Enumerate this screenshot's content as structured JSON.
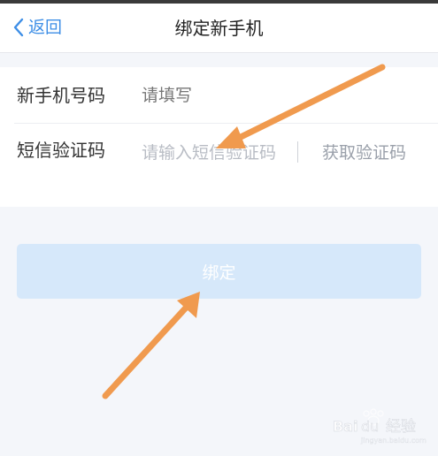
{
  "navbar": {
    "back_label": "返回",
    "title": "绑定新手机"
  },
  "form": {
    "phone": {
      "label": "新手机号码",
      "placeholder": "请填写"
    },
    "sms": {
      "label": "短信验证码",
      "placeholder": "请输入短信验证码",
      "get_code_label": "获取验证码"
    }
  },
  "bind_button": {
    "label": "绑定"
  },
  "watermark": {
    "brand": "Baidu",
    "suffix": "经验",
    "sub": "jingyan.baidu.com"
  },
  "colors": {
    "accent": "#3d8ee6",
    "button_bg": "#d6e8fa",
    "annotation_arrow": "#f09a4e"
  }
}
